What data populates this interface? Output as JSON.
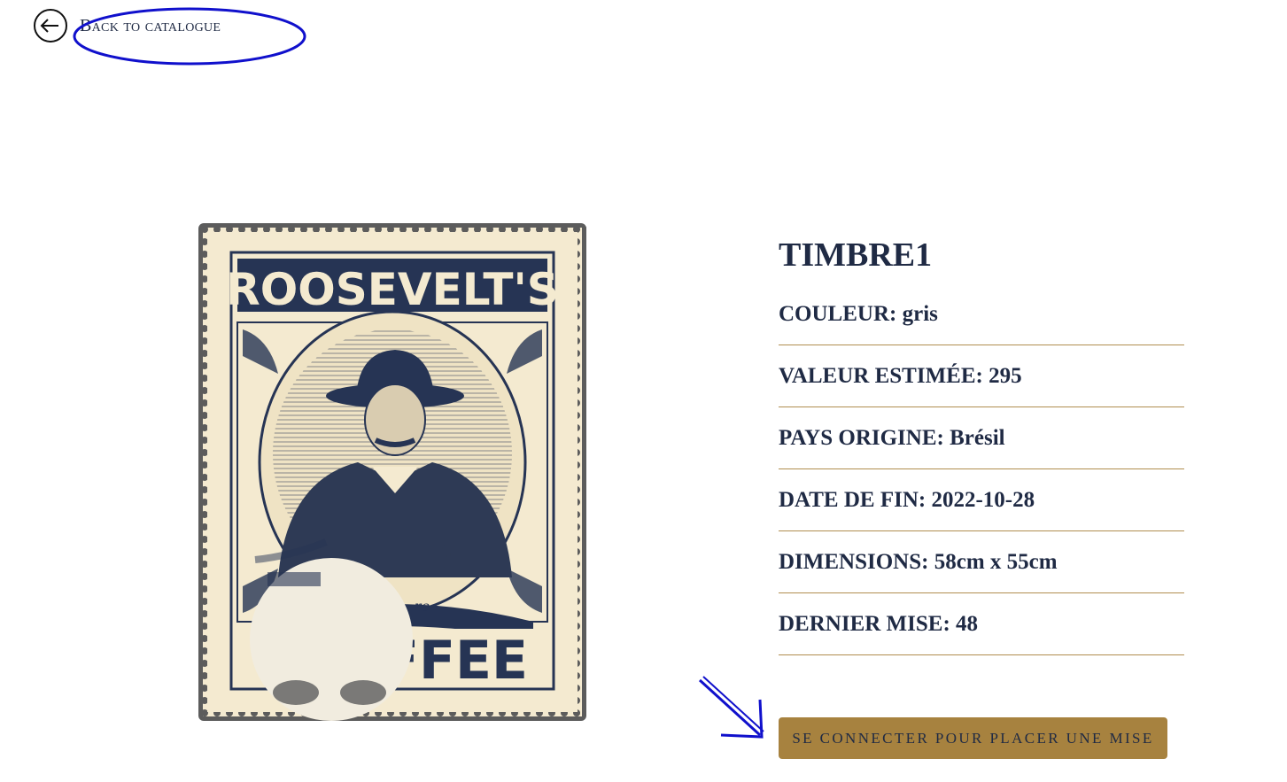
{
  "nav": {
    "back_label": "Back to catalogue",
    "back_icon": "arrow-left-circle-icon"
  },
  "stamp": {
    "top_text": "ROOSEVELT'S",
    "bottom_text": "FFEE",
    "script_text": "re"
  },
  "product": {
    "title": "TIMBRE1",
    "fields": [
      {
        "label": "COULEUR:",
        "value": "gris"
      },
      {
        "label": "VALEUR ESTIMÉE:",
        "value": "295"
      },
      {
        "label": "PAYS ORIGINE:",
        "value": "Brésil"
      },
      {
        "label": "DATE DE FIN:",
        "value": "2022-10-28"
      },
      {
        "label": "DIMENSIONS:",
        "value": "58cm x 55cm"
      },
      {
        "label": "DERNIER MISE:",
        "value": "48"
      }
    ]
  },
  "cta": {
    "label": "Se connecter pour placer une mise"
  },
  "colors": {
    "navy": "#1f2a44",
    "gold": "#a7823f",
    "cream": "#f4ead0",
    "annotation": "#1010cc"
  }
}
